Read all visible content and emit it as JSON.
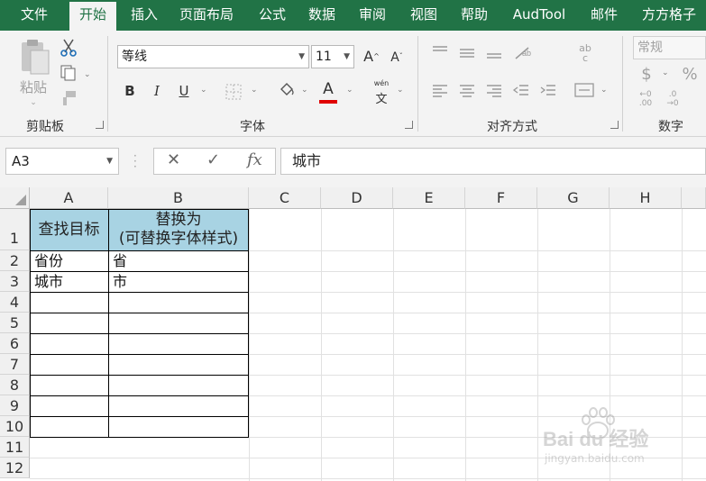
{
  "tabs": [
    "文件",
    "开始",
    "插入",
    "页面布局",
    "公式",
    "数据",
    "审阅",
    "视图",
    "帮助",
    "AudTool",
    "邮件",
    "方方格子"
  ],
  "active_tab": "开始",
  "ribbon": {
    "clipboard": {
      "paste_label": "粘贴",
      "group_label": "剪贴板"
    },
    "font": {
      "font_name": "等线",
      "font_size": "11",
      "bold": "B",
      "italic": "I",
      "underline": "U",
      "grow": "A",
      "shrink": "A",
      "font_color_glyph": "A",
      "font_color": "#e00000",
      "phonetic": "wén",
      "group_label": "字体"
    },
    "alignment": {
      "group_label": "对齐方式",
      "orient_text": "ab",
      "orient_text2": "c"
    },
    "number": {
      "format": "常规",
      "currency": "$",
      "percent": "%",
      "inc_dec": ".00",
      "dec_dec": ".0",
      "group_label": "数字"
    }
  },
  "formula_bar": {
    "name_box": "A3",
    "cancel": "✕",
    "enter": "✓",
    "fx": "fx",
    "formula": "城市"
  },
  "grid": {
    "columns": [
      "A",
      "B",
      "C",
      "D",
      "E",
      "F",
      "G",
      "H"
    ],
    "rows": [
      "1",
      "2",
      "3",
      "4",
      "5",
      "6",
      "7",
      "8",
      "9",
      "10",
      "11",
      "12"
    ],
    "header_fill": "#a8d3e3",
    "cells": {
      "A1": "查找目标",
      "B1_line1": "替换为",
      "B1_line2": "(可替换字体样式)",
      "A2": "省份",
      "B2": "省",
      "A3": "城市",
      "B3": "市"
    }
  },
  "watermark": {
    "text": "Bai du 经验",
    "url": "jingyan.baidu.com"
  }
}
